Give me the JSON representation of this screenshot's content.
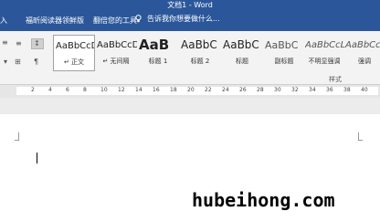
{
  "window": {
    "title": "文档1 - Word"
  },
  "tabs": [
    {
      "label": "插入"
    },
    {
      "label": "福昕阅读器领鲜版"
    },
    {
      "label": "翻倍您的工具"
    }
  ],
  "tell_me": {
    "text": "告诉我你想要做什么..."
  },
  "styles": [
    {
      "sample": "AaBbCcDd",
      "name": "↵ 正文"
    },
    {
      "sample": "AaBbCcDd",
      "name": "↵ 无间隔"
    },
    {
      "sample": "AaB",
      "name": "标题 1"
    },
    {
      "sample": "AaBbC",
      "name": "标题 2"
    },
    {
      "sample": "AaBbC",
      "name": "标题"
    },
    {
      "sample": "AaBbC",
      "name": "副标题"
    },
    {
      "sample": "AaBbCcL",
      "name": "不明显强调"
    },
    {
      "sample": "AaBbCcL",
      "name": "强调"
    }
  ],
  "styles_group_label": "样式",
  "ruler": {
    "numbers": [
      "2",
      "4",
      "6",
      "8",
      "10",
      "12",
      "14",
      "16",
      "18",
      "20",
      "22",
      "24",
      "26",
      "28",
      "30",
      "32",
      "34",
      "36",
      "38",
      "40"
    ]
  },
  "watermark": "hubeihong.com",
  "colors": {
    "accent": "#2b579a",
    "ribbon": "#f3f3f3"
  },
  "icons": {
    "tell_me": "lightbulb-icon",
    "pilcrow": "pilcrow-icon",
    "sort": "sort-icon"
  }
}
